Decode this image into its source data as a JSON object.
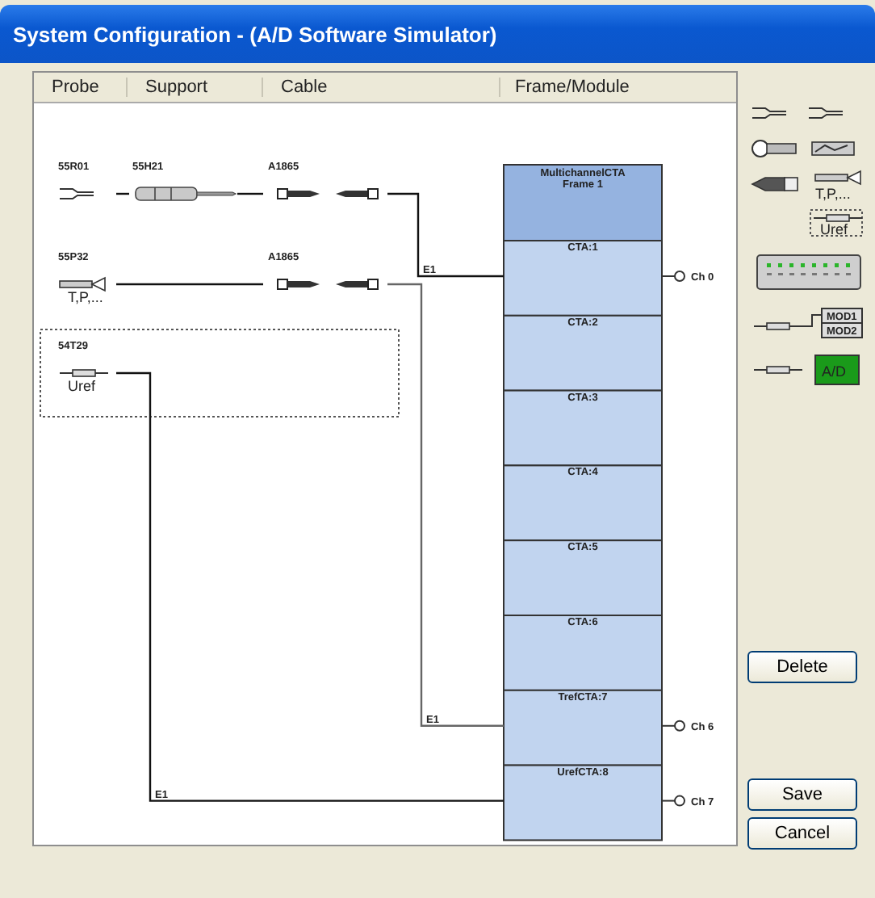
{
  "window": {
    "title": "System Configuration - (A/D Software Simulator)"
  },
  "columns": [
    "Probe",
    "Support",
    "Cable",
    "Frame/Module"
  ],
  "rows": [
    {
      "probe": "55R01",
      "kind": "fork",
      "support": "55H21",
      "cable": "A1865",
      "connection": "E1",
      "selected": false
    },
    {
      "probe": "55P32",
      "kind": "sensor",
      "probe_note": "T,P,...",
      "cable": "A1865",
      "connection": "E1",
      "selected": false
    },
    {
      "probe": "54T29",
      "kind": "ref",
      "probe_note": "Uref",
      "connection": "E1",
      "selected": true
    }
  ],
  "frame": {
    "title": [
      "MultichannelCTA",
      "Frame 1"
    ],
    "modules": [
      {
        "label": "CTA:1",
        "channel": "Ch 0"
      },
      {
        "label": "CTA:2"
      },
      {
        "label": "CTA:3"
      },
      {
        "label": "CTA:4"
      },
      {
        "label": "CTA:5"
      },
      {
        "label": "CTA:6"
      },
      {
        "label": "TrefCTA:7",
        "channel": "Ch 6"
      },
      {
        "label": "UrefCTA:8",
        "channel": "Ch 7"
      }
    ]
  },
  "toolbox": {
    "sensor_note": "T,P,...",
    "ref_note": "Uref",
    "module_labels": [
      "MOD1",
      "MOD2"
    ],
    "board_label": "A/D"
  },
  "buttons": {
    "delete": "Delete",
    "save": "Save",
    "cancel": "Cancel"
  }
}
